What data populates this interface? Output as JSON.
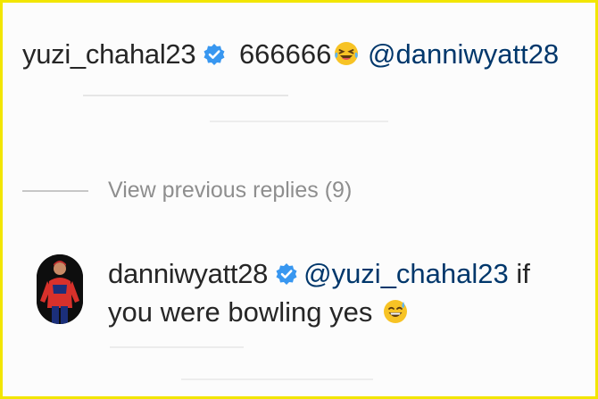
{
  "top_comment": {
    "username": "yuzi_chahal23",
    "text": "666666",
    "emoji": "face-with-tears-of-joy",
    "mention": "@danniwyatt28"
  },
  "view_previous_replies": "View previous replies (9)",
  "reply": {
    "username": "danniwyatt28",
    "mention": "@yuzi_chahal23",
    "text_line1_suffix": "if",
    "text_line2": "you were bowling yes",
    "emoji": "grinning-face-with-sweat"
  },
  "colors": {
    "frame": "#f2e600",
    "verified": "#3897f0",
    "mention": "#00376b",
    "secondary_text": "#8e8e8e"
  }
}
